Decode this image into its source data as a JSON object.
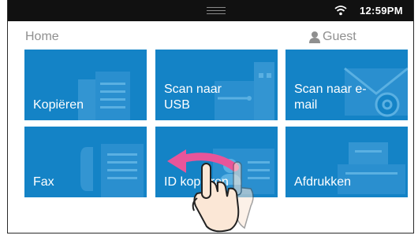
{
  "statusbar": {
    "time": "12:59PM"
  },
  "header": {
    "title": "Home",
    "user_label": "Guest"
  },
  "tiles": [
    {
      "label": "Kopiëren",
      "icon": "copy-icon"
    },
    {
      "label": "Scan naar\nUSB",
      "icon": "usb-icon"
    },
    {
      "label": "Scan naar e-\nmail",
      "icon": "email-icon"
    },
    {
      "label": "Fax",
      "icon": "fax-icon"
    },
    {
      "label": "ID kopiëren",
      "icon": "id-card-icon"
    },
    {
      "label": "Afdrukken",
      "icon": "printer-icon"
    }
  ],
  "colors": {
    "tile": "#1483c6",
    "statusbar": "#111111",
    "swipe_arrow": "#e8559a",
    "header_text": "#8f8f8f"
  },
  "gesture": {
    "icon": "swipe-left-hand-icon"
  }
}
